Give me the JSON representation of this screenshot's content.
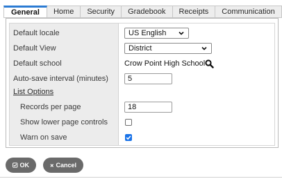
{
  "tabs": [
    {
      "label": "General",
      "active": true
    },
    {
      "label": "Home"
    },
    {
      "label": "Security"
    },
    {
      "label": "Gradebook"
    },
    {
      "label": "Receipts"
    },
    {
      "label": "Communication"
    }
  ],
  "form": {
    "default_locale": {
      "label": "Default locale",
      "value": "US English"
    },
    "default_view": {
      "label": "Default View",
      "value": "District"
    },
    "default_school": {
      "label": "Default school",
      "value": "Crow Point High School",
      "icon": "search-icon"
    },
    "autosave": {
      "label": "Auto-save interval (minutes)",
      "value": "5"
    },
    "list_options": {
      "label": "List Options"
    },
    "records_per_page": {
      "label": "Records per page",
      "value": "18"
    },
    "show_lower_controls": {
      "label": "Show lower page controls",
      "checked": false
    },
    "warn_on_save": {
      "label": "Warn on save",
      "checked": true
    }
  },
  "buttons": {
    "ok": {
      "label": "OK",
      "icon": "check-icon"
    },
    "cancel": {
      "label": "Cancel",
      "icon": "close-icon"
    }
  },
  "colors": {
    "accent_tab": "#2b7bd3",
    "checkbox_checked": "#1a73e8",
    "button_bg": "#6a6a6a",
    "label_column_bg": "#ececec"
  }
}
